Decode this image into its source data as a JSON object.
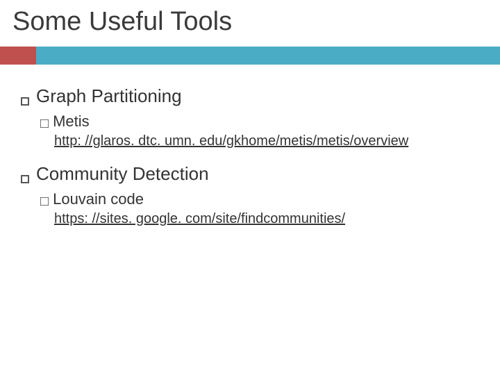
{
  "title": "Some Useful Tools",
  "items": [
    {
      "label": "Graph Partitioning",
      "sub": {
        "label": "Metis"
      },
      "link": "http: //glaros. dtc. umn. edu/gkhome/metis/metis/overview"
    },
    {
      "label": "Community Detection",
      "sub": {
        "label": "Louvain code"
      },
      "link": "https: //sites. google. com/site/findcommunities/"
    }
  ]
}
